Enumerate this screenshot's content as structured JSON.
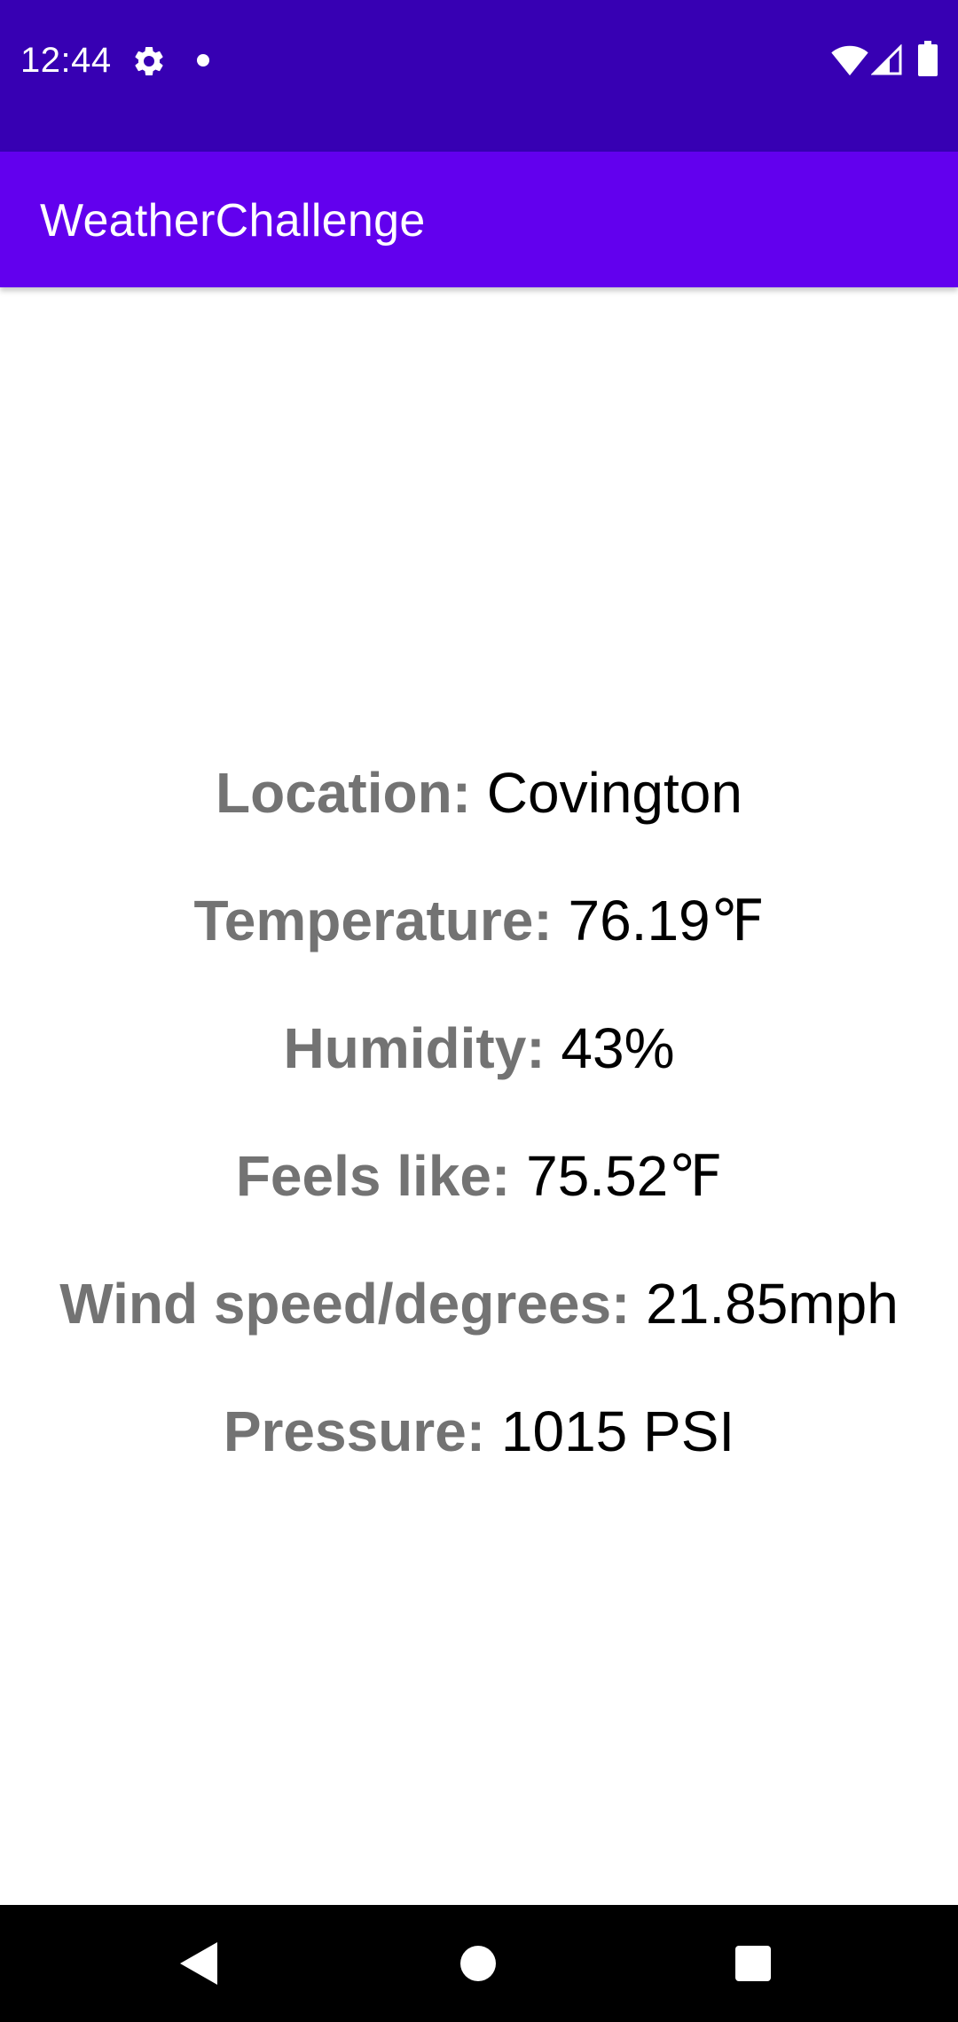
{
  "status_bar": {
    "time": "12:44",
    "icons": [
      "gear-icon",
      "notification-dot-icon",
      "wifi-icon",
      "cell-signal-icon",
      "battery-icon"
    ],
    "background": "#3700B3"
  },
  "app_bar": {
    "title": "WeatherChallenge",
    "background": "#6200EE"
  },
  "weather": {
    "rows": [
      {
        "label": "Location:",
        "value": "Covington"
      },
      {
        "label": "Temperature:",
        "value": "76.19℉"
      },
      {
        "label": "Humidity:",
        "value": "43%"
      },
      {
        "label": "Feels like:",
        "value": "75.52℉"
      },
      {
        "label": "Wind speed/degrees:",
        "value": "21.85mph"
      },
      {
        "label": "Pressure:",
        "value": "1015 PSI"
      }
    ],
    "label_color": "#737373",
    "value_color": "#000000"
  },
  "nav_bar": {
    "icons": [
      "back-icon",
      "home-icon",
      "recents-icon"
    ],
    "background": "#000000"
  }
}
